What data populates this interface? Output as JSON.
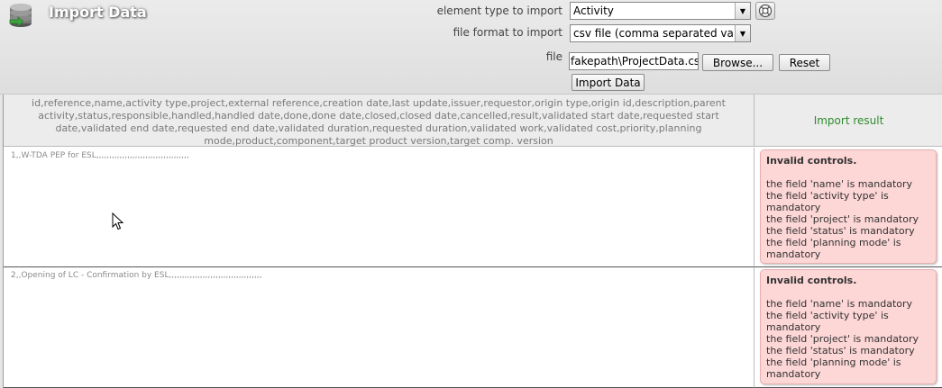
{
  "page": {
    "title": "Import Data"
  },
  "form": {
    "element_type_label": "element type to import",
    "element_type_value": "Activity",
    "file_format_label": "file format to import",
    "file_format_value": "csv file (comma separated valu",
    "file_label": "file",
    "file_value": "fakepath\\ProjectData.csv",
    "browse_label": "Browse...",
    "reset_label": "Reset",
    "import_label": "Import Data"
  },
  "table": {
    "columns_header": "id,reference,name,activity type,project,external reference,creation date,last update,issuer,requestor,origin type,origin id,description,parent activity,status,responsible,handled,handled date,done,done date,closed,closed date,cancelled,result,validated start date,requested start date,validated end date,requested end date,validated duration,requested duration,validated work,validated cost,priority,planning mode,product,component,target product version,target comp. version",
    "result_header": "Import result",
    "rows": [
      {
        "data": "1,,W-TDA PEP for ESL,,,,,,,,,,,,,,,,,,,,,,,,,,,,,,,,,,,,",
        "error_title": "Invalid controls.",
        "errors": [
          "the field 'name' is mandatory",
          "the field 'activity type' is mandatory",
          "the field 'project' is mandatory",
          "the field 'status' is mandatory",
          "the field 'planning mode' is mandatory"
        ]
      },
      {
        "data": "2,,Opening of LC - Confirmation by ESL,,,,,,,,,,,,,,,,,,,,,,,,,,,,,,,,,,,,",
        "error_title": "Invalid controls.",
        "errors": [
          "the field 'name' is mandatory",
          "the field 'activity type' is mandatory",
          "the field 'project' is mandatory",
          "the field 'status' is mandatory",
          "the field 'planning mode' is mandatory"
        ]
      }
    ]
  },
  "icons": {
    "app": "database-icon",
    "help": "help-icon",
    "dropdown": "chevron-down-icon",
    "cursor": "mouse-cursor-icon"
  }
}
